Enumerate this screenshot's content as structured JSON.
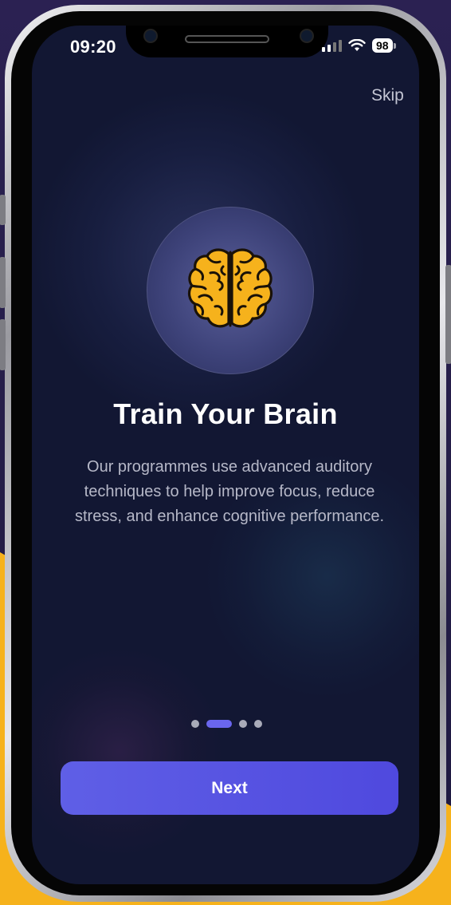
{
  "status_bar": {
    "time": "09:20",
    "battery": "98"
  },
  "header": {
    "skip_label": "Skip"
  },
  "onboarding": {
    "title": "Train Your Brain",
    "description": "Our programmes use advanced auditory techniques to help improve focus, reduce stress, and enhance cognitive performance.",
    "page_index": 2,
    "page_count": 4,
    "icon": "brain-icon"
  },
  "footer": {
    "next_label": "Next"
  },
  "colors": {
    "accent": "#5a56e6",
    "brain": "#f6b21c",
    "background": "#121733",
    "backdrop_accent": "#f7b31b"
  }
}
